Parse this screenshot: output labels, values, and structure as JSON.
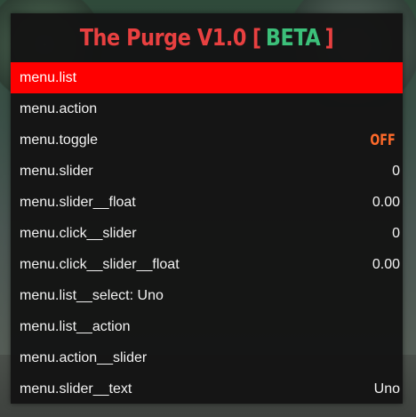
{
  "menu": {
    "title": {
      "name": "The Purge V1.0",
      "bracket_open": "[",
      "tag": "BETA",
      "bracket_close": "]"
    },
    "items": [
      {
        "label": "menu.list",
        "value": ""
      },
      {
        "label": "menu.action",
        "value": ""
      },
      {
        "label": "menu.toggle",
        "value": "OFF"
      },
      {
        "label": "menu.slider",
        "value": "0"
      },
      {
        "label": "menu.slider__float",
        "value": "0.00"
      },
      {
        "label": "menu.click__slider",
        "value": "0"
      },
      {
        "label": "menu.click__slider__float",
        "value": "0.00"
      },
      {
        "label": "menu.list__select: Uno",
        "value": ""
      },
      {
        "label": "menu.list__action",
        "value": ""
      },
      {
        "label": "menu.action__slider",
        "value": ""
      },
      {
        "label": "menu.slider__text",
        "value": "Uno"
      }
    ]
  },
  "colors": {
    "selected_background": "#ff0000",
    "title_red": "#e84040",
    "title_green": "#3cc07a",
    "toggle_off": "#ff6a2a"
  }
}
